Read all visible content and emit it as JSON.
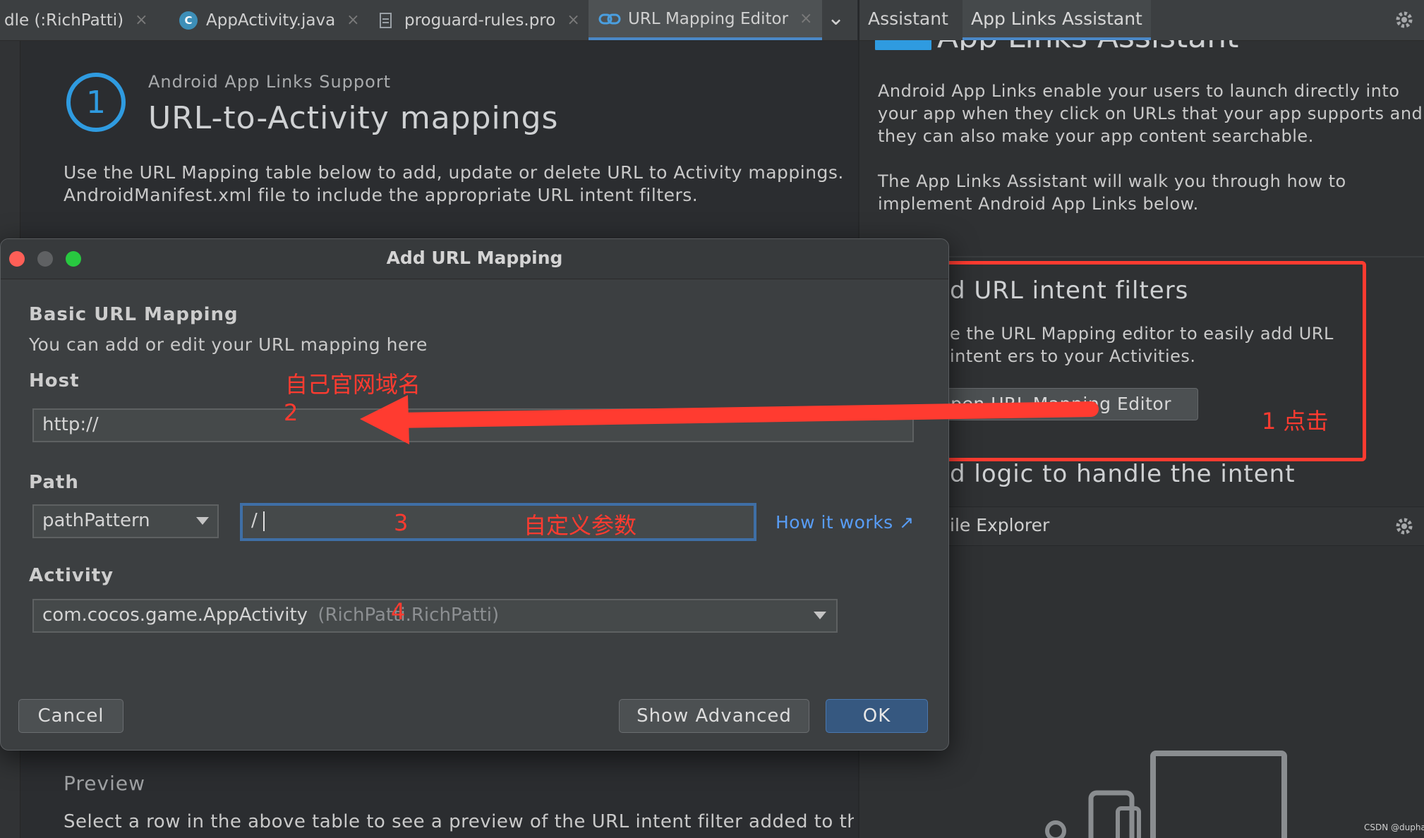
{
  "tabs": [
    {
      "label": "dle (:RichPatti)"
    },
    {
      "label": "AppActivity.java",
      "icon": "C"
    },
    {
      "label": "proguard-rules.pro"
    },
    {
      "label": "URL Mapping Editor"
    }
  ],
  "tab_close": "×",
  "tab_more": "⌄",
  "assistant": {
    "tab_assistant": "Assistant",
    "tab_app_links": "App Links Assistant",
    "header_partial": "App Links Assistant",
    "intro_1": "Android App Links enable your users to launch directly into your app when they click on URLs that your app supports and they can also make your app content searchable.",
    "intro_2": "The App Links Assistant will walk you through how to implement Android App Links below.",
    "step1_title": "d URL intent filters",
    "step1_desc": "e the URL Mapping editor to easily add URL intent ers to your Activities.",
    "open_editor_button": "Open URL Mapping Editor",
    "step2_title": "d logic to handle the intent",
    "file_explorer": "ile Explorer"
  },
  "editor": {
    "step_number": "1",
    "section_label": "Android App Links Support",
    "title": "URL-to-Activity mappings",
    "desc_1": "Use the URL Mapping table below to add, update or delete URL to Activity mappings.",
    "desc_2": "AndroidManifest.xml file to include the appropriate URL intent filters.",
    "preview_title": "Preview",
    "preview_desc": "Select a row in the above table to see a preview of the URL intent filter added to the a"
  },
  "dialog": {
    "title": "Add URL Mapping",
    "section_title": "Basic URL Mapping",
    "section_desc": "You can add or edit your URL mapping here",
    "host_label": "Host",
    "host_value": "http://",
    "path_label": "Path",
    "path_type": "pathPattern",
    "path_value": "/",
    "how_it_works": "How it works ↗",
    "activity_label": "Activity",
    "activity_value": "com.cocos.game.AppActivity",
    "activity_module": "(RichPatti.RichPatti)",
    "cancel": "Cancel",
    "show_advanced": "Show Advanced",
    "ok": "OK"
  },
  "annotations": {
    "click_1": "1 点击",
    "domain_note": "自己官网域名",
    "num_2": "2",
    "num_3": "3",
    "param_note": "自定义参数",
    "num_4": "4"
  },
  "watermark": "CSDN @dupha",
  "colors": {
    "accent_blue": "#4a88c7",
    "link_blue": "#589df6",
    "annotation_red": "#ff3b30",
    "ok_button": "#365880",
    "step_circle": "#2f9be0"
  }
}
